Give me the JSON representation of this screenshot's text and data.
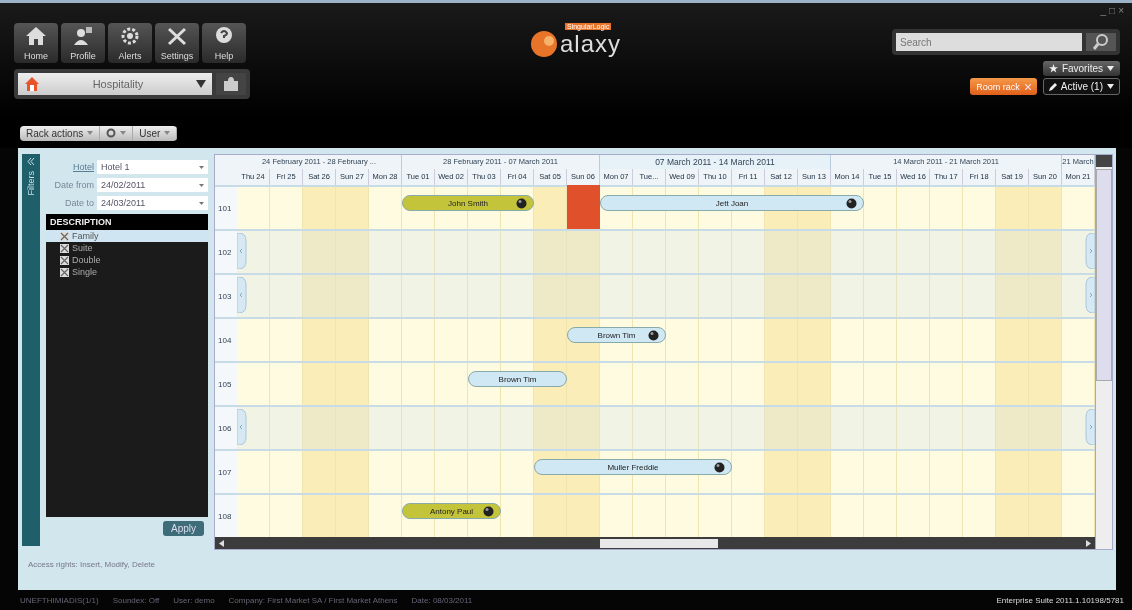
{
  "window_controls": [
    "_",
    "□",
    "×"
  ],
  "nav": [
    {
      "label": "Home"
    },
    {
      "label": "Profile"
    },
    {
      "label": "Alerts"
    },
    {
      "label": "Settings"
    },
    {
      "label": "Help"
    }
  ],
  "module": {
    "value": "Hospitality"
  },
  "logo": {
    "text": "alaxy",
    "brand": "SingularLogic"
  },
  "search": {
    "placeholder": "Search"
  },
  "favorites": {
    "label": "Favorites"
  },
  "open_tabs": [
    {
      "label": "Room rack",
      "selected": true
    }
  ],
  "active": {
    "label": "Active (1)"
  },
  "toolbar": [
    {
      "kind": "text",
      "label": "Rack actions"
    },
    {
      "kind": "gear"
    },
    {
      "kind": "text",
      "label": "User"
    }
  ],
  "filters": {
    "title": "Filters",
    "fields": [
      {
        "label": "Hotel",
        "value": "Hotel 1",
        "link": true
      },
      {
        "label": "Date from",
        "value": "24/02/2011",
        "link": false
      },
      {
        "label": "Date to",
        "value": "24/03/2011",
        "link": false
      }
    ],
    "list_title": "DESCRIPTION",
    "items": [
      {
        "label": "Family",
        "checked": true,
        "selected": true
      },
      {
        "label": "Suite",
        "checked": true,
        "selected": false
      },
      {
        "label": "Double",
        "checked": true,
        "selected": false
      },
      {
        "label": "Single",
        "checked": true,
        "selected": false
      }
    ],
    "apply": "Apply"
  },
  "rack": {
    "weeks": [
      {
        "label": "24 February 2011 - 28 February ...",
        "days": [
          {
            "label": "Thu 24",
            "weekend": false
          },
          {
            "label": "Fri 25",
            "weekend": false
          },
          {
            "label": "Sat 26",
            "weekend": true
          },
          {
            "label": "Sun 27",
            "weekend": true
          },
          {
            "label": "Mon 28",
            "weekend": false
          }
        ]
      },
      {
        "label": "28 February 2011 - 07 March 2011",
        "days": [
          {
            "label": "Tue 01",
            "weekend": false
          },
          {
            "label": "Wed 02",
            "weekend": false
          },
          {
            "label": "Thu 03",
            "weekend": false
          },
          {
            "label": "Fri 04",
            "weekend": false
          },
          {
            "label": "Sat 05",
            "weekend": true
          },
          {
            "label": "Sun 06",
            "weekend": true
          }
        ]
      },
      {
        "label": "07 March 2011 - 14 March 2011",
        "days": [
          {
            "label": "Mon 07",
            "weekend": false
          },
          {
            "label": "Tue...",
            "weekend": false
          },
          {
            "label": "Wed 09",
            "weekend": false
          },
          {
            "label": "Thu 10",
            "weekend": false
          },
          {
            "label": "Fri 11",
            "weekend": false
          },
          {
            "label": "Sat 12",
            "weekend": true
          },
          {
            "label": "Sun 13",
            "weekend": true
          }
        ]
      },
      {
        "label": "14 March 2011 - 21 March 2011",
        "days": [
          {
            "label": "Mon 14",
            "weekend": false
          },
          {
            "label": "Tue 15",
            "weekend": false
          },
          {
            "label": "Wed 16",
            "weekend": false
          },
          {
            "label": "Thu 17",
            "weekend": false
          },
          {
            "label": "Fri 18",
            "weekend": false
          },
          {
            "label": "Sat 19",
            "weekend": true
          },
          {
            "label": "Sun 20",
            "weekend": true
          }
        ]
      },
      {
        "label": "21 March",
        "days": [
          {
            "label": "Mon 21",
            "weekend": false
          }
        ]
      }
    ],
    "rooms": [
      {
        "number": "101",
        "collapsed": false,
        "segments": [
          {
            "kind": "free"
          },
          {
            "kind": "free"
          },
          {
            "kind": "free"
          },
          {
            "kind": "free"
          },
          {
            "kind": "free"
          },
          {
            "kind": "booking",
            "guest": "John Smith",
            "color": "#c3c43a",
            "marker": true,
            "nights": [
              {
                "kind": "night"
              },
              {
                "kind": "night"
              },
              {
                "kind": "night"
              },
              {
                "kind": "night"
              }
            ]
          },
          {
            "kind": "free"
          },
          {
            "kind": "blocked",
            "color": "#e0502a"
          },
          {
            "kind": "booking",
            "guest": "Jett Joan",
            "color": "#cfe8f4",
            "marker": true,
            "nights": [
              {
                "kind": "night"
              },
              {
                "kind": "night"
              },
              {
                "kind": "night"
              },
              {
                "kind": "night"
              },
              {
                "kind": "night"
              },
              {
                "kind": "night"
              },
              {
                "kind": "night"
              },
              {
                "kind": "night"
              }
            ]
          }
        ]
      },
      {
        "number": "102",
        "collapsed": true
      },
      {
        "number": "103",
        "collapsed": true
      },
      {
        "number": "104",
        "collapsed": false,
        "segments": [
          {
            "kind": "free"
          },
          {
            "kind": "free"
          },
          {
            "kind": "free"
          },
          {
            "kind": "free"
          },
          {
            "kind": "free"
          },
          {
            "kind": "free"
          },
          {
            "kind": "free"
          },
          {
            "kind": "free"
          },
          {
            "kind": "free"
          },
          {
            "kind": "free"
          },
          {
            "kind": "booking",
            "guest": "Brown Tim",
            "color": "#cfe8f4",
            "marker": true,
            "nights": [
              {
                "kind": "night"
              },
              {
                "kind": "night"
              },
              {
                "kind": "night"
              }
            ]
          }
        ]
      },
      {
        "number": "105",
        "collapsed": false,
        "segments": [
          {
            "kind": "free"
          },
          {
            "kind": "free"
          },
          {
            "kind": "free"
          },
          {
            "kind": "free"
          },
          {
            "kind": "free"
          },
          {
            "kind": "free"
          },
          {
            "kind": "free"
          },
          {
            "kind": "booking",
            "guest": "Brown Tim",
            "color": "#cfe8f4",
            "marker": false,
            "nights": [
              {
                "kind": "night"
              },
              {
                "kind": "night"
              },
              {
                "kind": "night"
              }
            ]
          }
        ]
      },
      {
        "number": "106",
        "collapsed": true
      },
      {
        "number": "107",
        "collapsed": false,
        "segments": [
          {
            "kind": "free"
          },
          {
            "kind": "free"
          },
          {
            "kind": "free"
          },
          {
            "kind": "free"
          },
          {
            "kind": "free"
          },
          {
            "kind": "free"
          },
          {
            "kind": "free"
          },
          {
            "kind": "free"
          },
          {
            "kind": "free"
          },
          {
            "kind": "booking",
            "guest": "Muller Freddie",
            "color": "#cfe8f4",
            "marker": true,
            "nights": [
              {
                "kind": "night"
              },
              {
                "kind": "night"
              },
              {
                "kind": "night"
              },
              {
                "kind": "night"
              },
              {
                "kind": "night"
              },
              {
                "kind": "night"
              }
            ]
          }
        ]
      },
      {
        "number": "108",
        "collapsed": false,
        "segments": [
          {
            "kind": "free"
          },
          {
            "kind": "free"
          },
          {
            "kind": "free"
          },
          {
            "kind": "free"
          },
          {
            "kind": "free"
          },
          {
            "kind": "booking",
            "guest": "Antony Paul",
            "color": "#c3c43a",
            "marker": true,
            "nights": [
              {
                "kind": "night"
              },
              {
                "kind": "night"
              },
              {
                "kind": "night"
              }
            ]
          }
        ]
      }
    ]
  },
  "access_rights": "Access rights: Insert, Modify, Delete",
  "status_bar": {
    "items": [
      "UNEFTHIMIADIS(1/1)",
      "Soundex: Off",
      "User: demo",
      "Company: First Market SA / First Market Athens",
      "Date: 08/03/2011"
    ],
    "version": "Enterprise Suite 2011.1.10198/5781"
  }
}
